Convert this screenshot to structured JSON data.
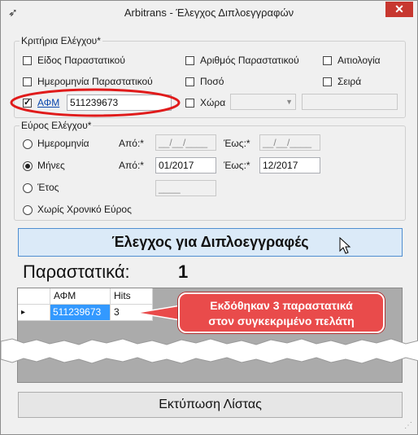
{
  "window": {
    "title": "Arbitrans - Έλεγχος Διπλοεγγραφών",
    "app_icon": "bird-logo-icon",
    "close_icon": "close-icon"
  },
  "criteria": {
    "legend": "Κριτήρια Ελέγχου*",
    "doc_type": {
      "label": "Είδος Παραστατικού",
      "checked": false
    },
    "doc_number": {
      "label": "Αριθμός Παραστατικού",
      "checked": false
    },
    "reason": {
      "label": "Αιτιολογία",
      "checked": false
    },
    "doc_date": {
      "label": "Ημερομηνία Παραστατικού",
      "checked": false
    },
    "amount": {
      "label": "Ποσό",
      "checked": false
    },
    "series": {
      "label": "Σειρά",
      "checked": false
    },
    "afm": {
      "label": "ΑΦΜ",
      "checked": true,
      "value": "511239673"
    },
    "country": {
      "label": "Χώρα",
      "checked": false,
      "value": ""
    }
  },
  "range": {
    "legend": "Εύρος Ελέγχου*",
    "date": {
      "label": "Ημερομηνία",
      "selected": false,
      "from_label": "Από:*",
      "to_label": "Έως:*",
      "from": "__/__/____",
      "to": "__/__/____"
    },
    "months": {
      "label": "Μήνες",
      "selected": true,
      "from_label": "Από:*",
      "to_label": "Έως:*",
      "from": "01/2017",
      "to": "12/2017"
    },
    "year": {
      "label": "Έτος",
      "selected": false,
      "value": "____"
    },
    "none": {
      "label": "Χωρίς Χρονικό Εύρος",
      "selected": false
    }
  },
  "check_button": "Έλεγχος για Διπλοεγγραφές",
  "result": {
    "label": "Παραστατικά:",
    "count": "1"
  },
  "grid": {
    "columns": [
      "ΑΦΜ",
      "Hits"
    ],
    "rows": [
      {
        "afm": "511239673",
        "hits": "3"
      }
    ],
    "row_indicator": "▸"
  },
  "callout": {
    "line1": "Εκδόθηκαν 3 παραστατικά",
    "line2": "στον συγκεκριμένο πελάτη"
  },
  "print_button": "Εκτύπωση Λίστας",
  "colors": {
    "accent": "#0078d7",
    "highlight_ring": "#e01b1b",
    "callout": "#e94b4b",
    "selected_cell": "#3399ff"
  }
}
